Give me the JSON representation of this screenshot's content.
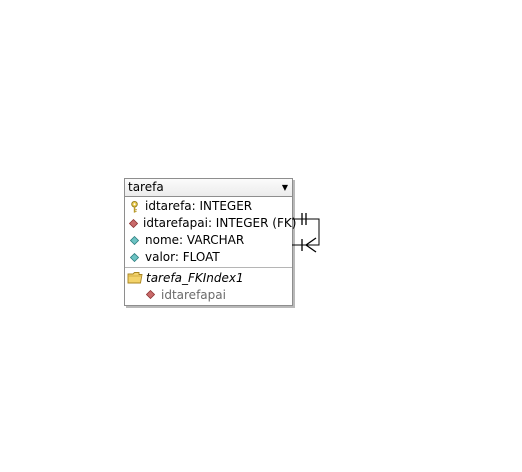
{
  "entity": {
    "name": "tarefa",
    "columns": [
      {
        "text": "idtarefa: INTEGER",
        "icon": "primary-key-icon"
      },
      {
        "text": "idtarefapai: INTEGER (FK)",
        "icon": "foreign-key-diamond-icon",
        "color": "#c0504d"
      },
      {
        "text": "nome: VARCHAR",
        "icon": "column-diamond-icon",
        "color": "#4aa3a6"
      },
      {
        "text": "valor: FLOAT",
        "icon": "column-diamond-icon",
        "color": "#4aa3a6"
      }
    ],
    "index": {
      "name": "tarefa_FKIndex1",
      "icon": "index-folder-icon",
      "columns": [
        {
          "text": "idtarefapai",
          "icon": "foreign-key-diamond-icon",
          "color": "#c0504d"
        }
      ]
    }
  },
  "relationship": {
    "type": "self-referencing",
    "start_notation": "one-and-only-one",
    "end_notation": "zero-or-many",
    "line_color": "#000000"
  }
}
